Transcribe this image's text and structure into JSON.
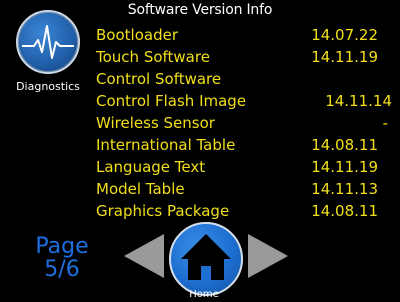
{
  "header": {
    "title": "Software Version Info"
  },
  "diagnostics": {
    "label": "Diagnostics",
    "icon": "heartbeat-icon"
  },
  "versions": [
    {
      "label": "Bootloader",
      "value": "14.07.22"
    },
    {
      "label": "Touch Software",
      "value": "14.11.19"
    },
    {
      "label": "Control Software",
      "value": ""
    },
    {
      "label": "Control Flash Image",
      "value": "14.11.14"
    },
    {
      "label": "Wireless Sensor",
      "value": "-"
    },
    {
      "label": "International Table",
      "value": "14.08.11"
    },
    {
      "label": "Language Text",
      "value": "14.11.19"
    },
    {
      "label": "Model Table",
      "value": "14.11.13"
    },
    {
      "label": "Graphics Package",
      "value": "14.08.11"
    }
  ],
  "pager": {
    "line1": "Page",
    "line2": "5/6"
  },
  "nav": {
    "home_label": "Home",
    "prev_icon": "arrow-left-icon",
    "next_icon": "arrow-right-icon",
    "home_icon": "home-icon"
  },
  "colors": {
    "text_value": "#f2df1a",
    "page_text": "#1e6fe0",
    "button_blue": "#1d6ed0",
    "arrow_gray": "#9a9a9a"
  }
}
